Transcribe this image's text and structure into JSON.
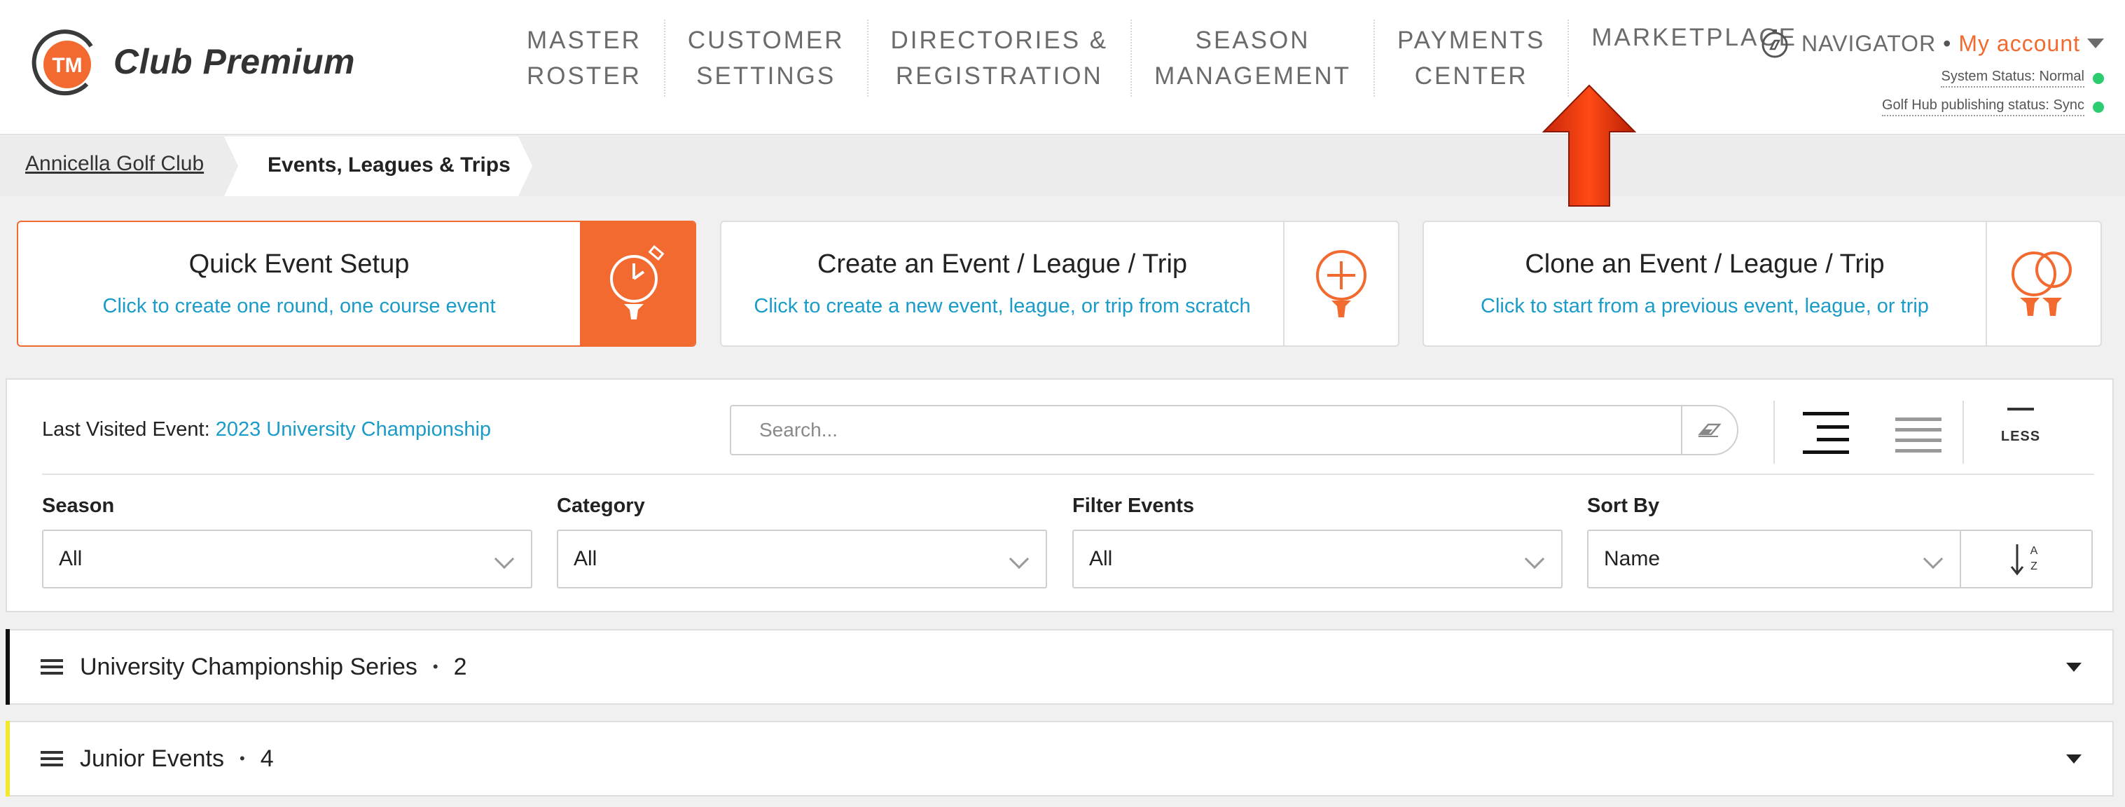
{
  "app": {
    "logo_badge": "TM",
    "logo_text": "Club Premium"
  },
  "nav": {
    "items": [
      {
        "line1": "MASTER",
        "line2": "ROSTER"
      },
      {
        "line1": "CUSTOMER",
        "line2": "SETTINGS"
      },
      {
        "line1": "DIRECTORIES &",
        "line2": "REGISTRATION"
      },
      {
        "line1": "SEASON",
        "line2": "MANAGEMENT"
      },
      {
        "line1": "PAYMENTS",
        "line2": "CENTER"
      },
      {
        "line1": "MARKETPLACE",
        "line2": ""
      }
    ]
  },
  "account": {
    "navigator": "NAVIGATOR",
    "separator": "•",
    "my_account": "My account",
    "system_status": "System Status: Normal",
    "hub_status": "Golf Hub publishing status: Sync",
    "status_color": "#2ecc71"
  },
  "breadcrumb": {
    "club": "Annicella Golf Club",
    "current": "Events, Leagues & Trips"
  },
  "cards": [
    {
      "title": "Quick Event Setup",
      "subtitle": "Click to create one round, one course event",
      "icon": "stopwatch-tee-icon"
    },
    {
      "title": "Create an Event / League / Trip",
      "subtitle": "Click to create a new event, league, or trip from scratch",
      "icon": "plus-tee-icon"
    },
    {
      "title": "Clone an Event / League / Trip",
      "subtitle": "Click to start from a previous event, league, or trip",
      "icon": "double-tee-icon"
    }
  ],
  "filters": {
    "last_visited_label": "Last Visited Event:",
    "last_visited_event": "2023 University Championship",
    "search_placeholder": "Search...",
    "less_label": "LESS",
    "season_label": "Season",
    "season_value": "All",
    "category_label": "Category",
    "category_value": "All",
    "filter_label": "Filter Events",
    "filter_value": "All",
    "sort_label": "Sort By",
    "sort_value": "Name",
    "sort_dir_top": "A",
    "sort_dir_bottom": "Z"
  },
  "categories": [
    {
      "name": "University Championship Series",
      "sep": "•",
      "count": "2",
      "color": "#111111"
    },
    {
      "name": "Junior Events",
      "sep": "•",
      "count": "4",
      "color": "#f2e830"
    }
  ],
  "colors": {
    "accent": "#f26a30",
    "link": "#1a9bc8"
  }
}
